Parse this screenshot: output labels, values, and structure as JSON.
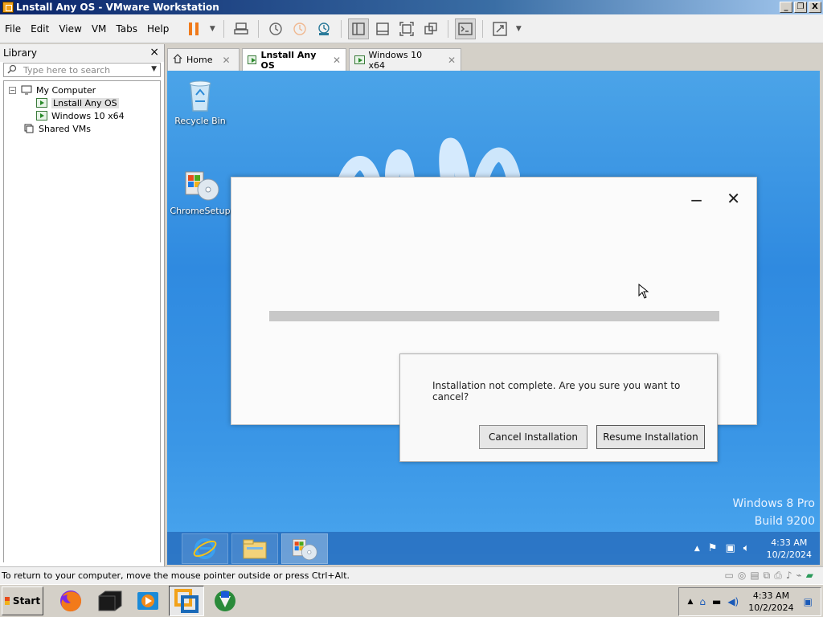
{
  "window": {
    "title": "Lnstall Any OS - VMware Workstation",
    "minimize": "_",
    "restore": "❐",
    "close": "X"
  },
  "menu": {
    "items": [
      "File",
      "Edit",
      "View",
      "VM",
      "Tabs",
      "Help"
    ]
  },
  "library": {
    "title": "Library",
    "close": "×",
    "search_placeholder": "Type here to search",
    "tree": {
      "root": "My Computer",
      "vms": [
        "Lnstall Any OS",
        "Windows 10 x64"
      ],
      "shared": "Shared VMs"
    }
  },
  "tabs": [
    {
      "label": "Home"
    },
    {
      "label": "Lnstall Any OS"
    },
    {
      "label": "Windows 10 x64"
    }
  ],
  "desktop": {
    "icons": [
      "Recycle Bin",
      "ChromeSetup"
    ],
    "watermark_line1": "Windows 8 Pro",
    "watermark_line2": "Build 9200"
  },
  "installer": {
    "minimize": "−",
    "close": "✕"
  },
  "dialog": {
    "message": "Installation not complete. Are you sure you want to cancel?",
    "cancel_label": "Cancel Installation",
    "resume_label": "Resume Installation"
  },
  "guest_taskbar": {
    "time": "4:33 AM",
    "date": "10/2/2024"
  },
  "statusbar": {
    "text": "To return to your computer, move the mouse pointer outside or press Ctrl+Alt."
  },
  "host_taskbar": {
    "start_label": "Start",
    "time": "4:33 AM",
    "date": "10/2/2024"
  },
  "colors": {
    "desktop_blue": "#2f8ae0",
    "title_blue": "#0a246a"
  }
}
